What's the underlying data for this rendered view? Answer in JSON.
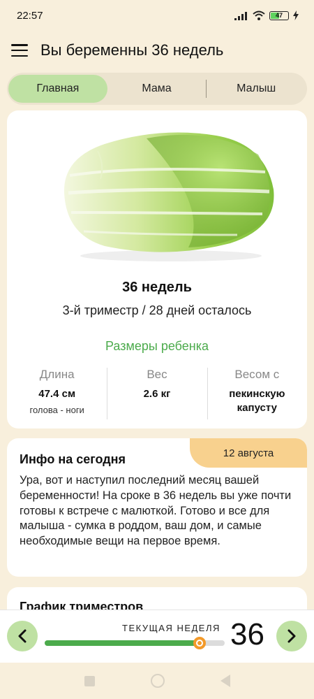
{
  "status": {
    "time": "22:57",
    "battery_level": "47"
  },
  "header": {
    "title": "Вы беременны 36 недель"
  },
  "tabs": [
    {
      "label": "Главная",
      "active": true
    },
    {
      "label": "Мама",
      "active": false
    },
    {
      "label": "Малыш",
      "active": false
    }
  ],
  "main_card": {
    "image_icon": "napa-cabbage",
    "week_title": "36 недель",
    "trimester": "3-й триместр / 28 дней осталось",
    "sizes_title": "Размеры ребенка",
    "stats": [
      {
        "label": "Длина",
        "value": "47.4 см",
        "sub": "голова - ноги"
      },
      {
        "label": "Вес",
        "value": "2.6 кг",
        "sub": ""
      },
      {
        "label": "Весом с",
        "value": "пекинскую капусту",
        "sub": ""
      }
    ]
  },
  "info_card": {
    "date": "12 августа",
    "title": "Инфо на сегодня",
    "text": "Ура, вот и наступил последний месяц вашей беременности! На сроке в 36 недель вы уже почти готовы к встрече с малюткой. Готово и все для малыша - сумка в роддом, ваш дом, и самые необходимые вещи на первое время."
  },
  "graph_card": {
    "title": "График триместров"
  },
  "week_nav": {
    "label": "ТЕКУЩАЯ НЕДЕЛЯ",
    "week": "36",
    "progress_fraction": 0.86
  },
  "colors": {
    "accent_green": "#4cab4c",
    "tab_active": "#bfe1a3",
    "background": "#f8efdc",
    "knob": "#f39a2a",
    "date_badge": "#f8d18e"
  }
}
